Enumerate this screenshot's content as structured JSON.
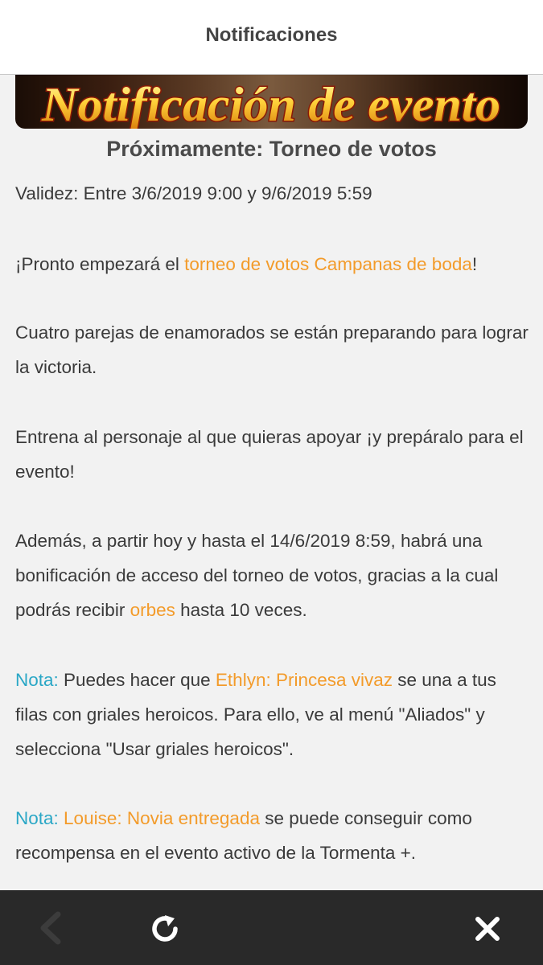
{
  "header": {
    "title": "Notificaciones"
  },
  "banner": {
    "text": "Notificación de evento"
  },
  "article": {
    "title": "Próximamente: Torneo de votos",
    "validity": "Validez: Entre 3/6/2019 9:00 y 9/6/2019 5:59",
    "p1": {
      "before": "¡Pronto empezará el ",
      "link": "torneo de votos Campanas de boda",
      "after": "!"
    },
    "p2": "Cuatro parejas de enamorados se están preparando para lograr la victoria.",
    "p3": "Entrena al personaje al que quieras apoyar ¡y prepáralo para el evento!",
    "p4": {
      "before": "Además, a partir hoy y hasta el 14/6/2019 8:59, habrá una bonificación de acceso del torneo de votos, gracias a la cual podrás recibir ",
      "link": "orbes",
      "after": " hasta 10 veces."
    },
    "note1": {
      "label": "Nota:",
      "before": " Puedes hacer que ",
      "link": "Ethlyn: Princesa vivaz",
      "after": " se una a tus filas con griales heroicos. Para ello, ve al menú \"Aliados\" y selecciona \"Usar griales heroicos\"."
    },
    "note2": {
      "label": "Nota:",
      "link": "Louise: Novia entregada",
      "after": " se puede conseguir como recompensa en el evento activo de la Tormenta +."
    }
  },
  "footer": {
    "back_icon": "chevron-left-icon",
    "refresh_icon": "refresh-icon",
    "close_icon": "close-icon"
  },
  "colors": {
    "highlight": "#f39b2a",
    "note": "#2aa7c6",
    "footer_bg": "#292929",
    "page_bg": "#f2f2f2"
  }
}
